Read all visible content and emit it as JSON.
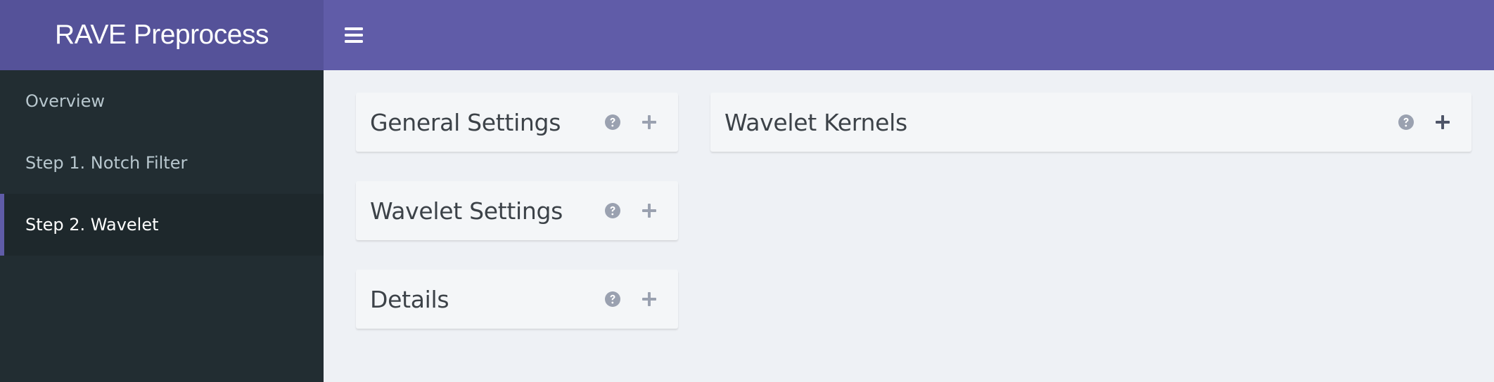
{
  "header": {
    "app_title": "RAVE Preprocess",
    "menu_icon": "hamburger-icon",
    "brand_color": "#605ca8",
    "logo_bg_color": "#555299"
  },
  "sidebar": {
    "items": [
      {
        "label": "Overview",
        "active": false
      },
      {
        "label": "Step 1. Notch Filter",
        "active": false
      },
      {
        "label": "Step 2. Wavelet",
        "active": true
      }
    ],
    "bg_color": "#222d32",
    "active_accent": "#605ca8"
  },
  "main": {
    "bg_color": "#eef1f5",
    "boxes": [
      {
        "title": "General Settings",
        "help_icon": "question-circle-icon",
        "expand_icon": "plus-icon",
        "collapsed": true
      },
      {
        "title": "Wavelet Settings",
        "help_icon": "question-circle-icon",
        "expand_icon": "plus-icon",
        "collapsed": true
      },
      {
        "title": "Details",
        "help_icon": "question-circle-icon",
        "expand_icon": "plus-icon",
        "collapsed": true
      },
      {
        "title": "Wavelet Kernels",
        "help_icon": "question-circle-icon",
        "expand_icon": "plus-icon",
        "collapsed": true
      }
    ]
  }
}
